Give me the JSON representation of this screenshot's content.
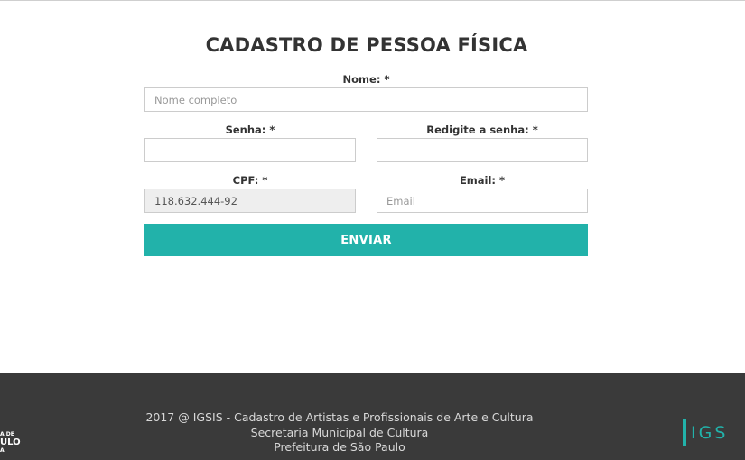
{
  "form": {
    "title": "CADASTRO DE PESSOA FÍSICA",
    "nome": {
      "label": "Nome: *",
      "value": "",
      "placeholder": "Nome completo"
    },
    "senha": {
      "label": "Senha: *",
      "value": ""
    },
    "redigite": {
      "label": "Redigite a senha: *",
      "value": ""
    },
    "cpf": {
      "label": "CPF: *",
      "value": "118.632.444-92"
    },
    "email": {
      "label": "Email: *",
      "value": "",
      "placeholder": "Email"
    },
    "submit_label": "ENVIAR"
  },
  "footer": {
    "lines": [
      "2017 @ IGSIS - Cadastro de Artistas e Profissionais de Arte e Cultura",
      "Secretaria Municipal de Cultura",
      "Prefeitura de São Paulo"
    ],
    "pref_logo_lines": [
      "A DE",
      "ULO",
      "A"
    ],
    "igsis_logo_text": "IGS"
  },
  "colors": {
    "accent": "#22b2aa",
    "footer_bg": "#3a3a3a",
    "readonly_bg": "#eeeeee"
  }
}
